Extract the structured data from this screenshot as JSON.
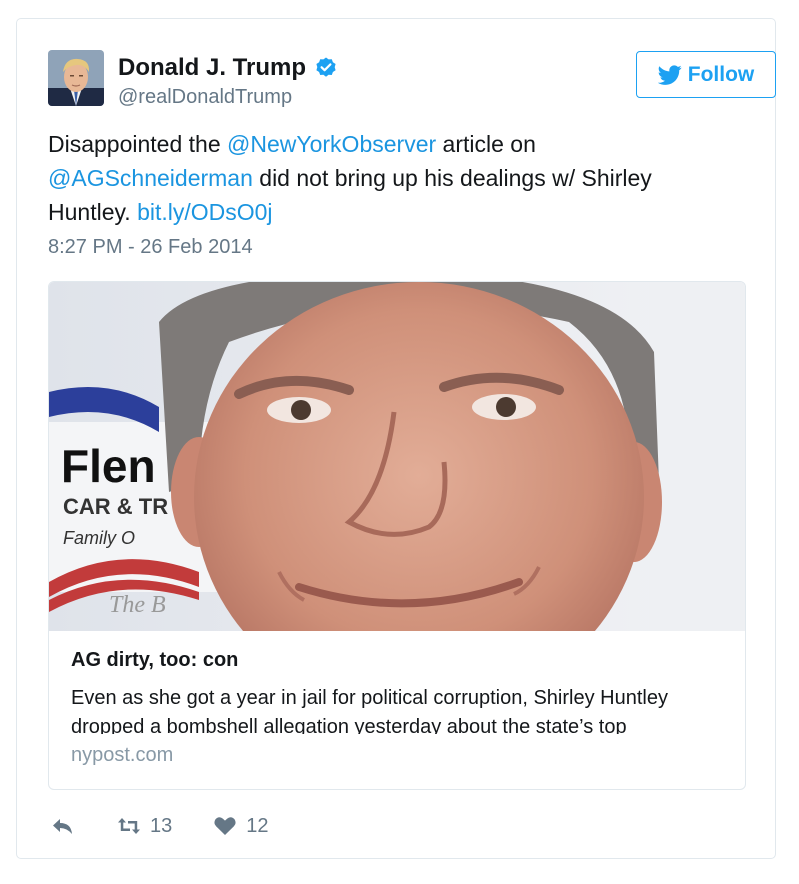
{
  "colors": {
    "accent": "#1da1f2",
    "link": "#1b95e0",
    "secondary_text": "#657786",
    "muted_text": "#8899a6",
    "border": "#e1e8ed"
  },
  "user": {
    "display_name": "Donald J. Trump",
    "handle": "@realDonaldTrump",
    "verified": true,
    "avatar_icon": "avatar-photo",
    "verified_icon": "verified-badge-icon"
  },
  "follow_button": {
    "label": "Follow",
    "icon": "twitter-bird-icon"
  },
  "tweet": {
    "part1": "Disappointed the ",
    "mention1": "@NewYorkObserver",
    "part2": " article on ",
    "mention2": "@AGSchneiderman",
    "part3": " did not bring up his dealings w/ Shirley Huntley. ",
    "url": "bit.ly/ODsO0j",
    "timestamp": "8:27 PM - 26 Feb 2014"
  },
  "link_card": {
    "title": "AG dirty, too: con",
    "description": "Even as she got a year in jail for political corruption, Shirley Huntley dropped a bombshell allegation yesterday about the state’s top",
    "domain": "nypost.com",
    "image_text": {
      "sign_line1": "Flen",
      "sign_line2": "CAR & TR",
      "sign_line3": "Family O",
      "sign_line4": "The B"
    }
  },
  "actions": {
    "reply_icon": "reply-icon",
    "retweet_icon": "retweet-icon",
    "retweet_count": "13",
    "like_icon": "heart-icon",
    "like_count": "12"
  }
}
